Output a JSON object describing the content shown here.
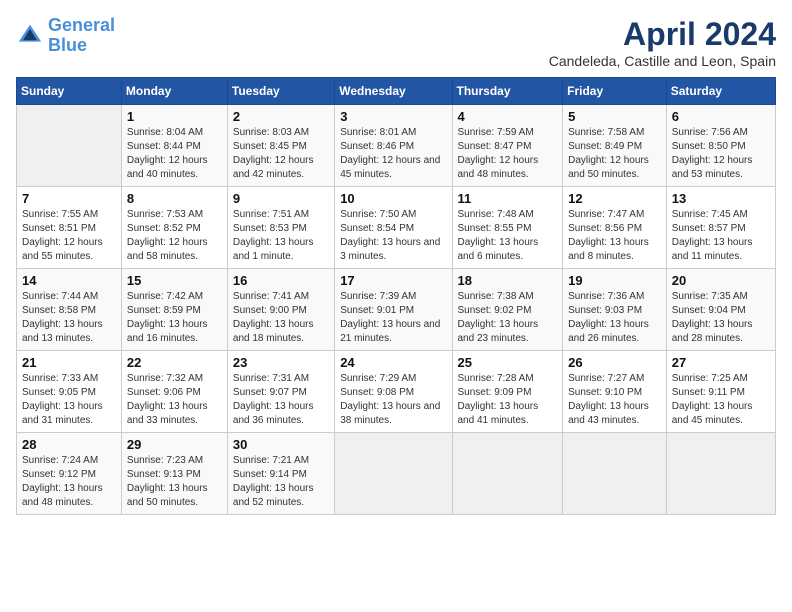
{
  "logo": {
    "line1": "General",
    "line2": "Blue"
  },
  "title": "April 2024",
  "subtitle": "Candeleda, Castille and Leon, Spain",
  "header_days": [
    "Sunday",
    "Monday",
    "Tuesday",
    "Wednesday",
    "Thursday",
    "Friday",
    "Saturday"
  ],
  "weeks": [
    [
      {
        "day": "",
        "empty": true
      },
      {
        "day": "1",
        "sunrise": "8:04 AM",
        "sunset": "8:44 PM",
        "daylight": "12 hours and 40 minutes."
      },
      {
        "day": "2",
        "sunrise": "8:03 AM",
        "sunset": "8:45 PM",
        "daylight": "12 hours and 42 minutes."
      },
      {
        "day": "3",
        "sunrise": "8:01 AM",
        "sunset": "8:46 PM",
        "daylight": "12 hours and 45 minutes."
      },
      {
        "day": "4",
        "sunrise": "7:59 AM",
        "sunset": "8:47 PM",
        "daylight": "12 hours and 48 minutes."
      },
      {
        "day": "5",
        "sunrise": "7:58 AM",
        "sunset": "8:49 PM",
        "daylight": "12 hours and 50 minutes."
      },
      {
        "day": "6",
        "sunrise": "7:56 AM",
        "sunset": "8:50 PM",
        "daylight": "12 hours and 53 minutes."
      }
    ],
    [
      {
        "day": "7",
        "sunrise": "7:55 AM",
        "sunset": "8:51 PM",
        "daylight": "12 hours and 55 minutes."
      },
      {
        "day": "8",
        "sunrise": "7:53 AM",
        "sunset": "8:52 PM",
        "daylight": "12 hours and 58 minutes."
      },
      {
        "day": "9",
        "sunrise": "7:51 AM",
        "sunset": "8:53 PM",
        "daylight": "13 hours and 1 minute."
      },
      {
        "day": "10",
        "sunrise": "7:50 AM",
        "sunset": "8:54 PM",
        "daylight": "13 hours and 3 minutes."
      },
      {
        "day": "11",
        "sunrise": "7:48 AM",
        "sunset": "8:55 PM",
        "daylight": "13 hours and 6 minutes."
      },
      {
        "day": "12",
        "sunrise": "7:47 AM",
        "sunset": "8:56 PM",
        "daylight": "13 hours and 8 minutes."
      },
      {
        "day": "13",
        "sunrise": "7:45 AM",
        "sunset": "8:57 PM",
        "daylight": "13 hours and 11 minutes."
      }
    ],
    [
      {
        "day": "14",
        "sunrise": "7:44 AM",
        "sunset": "8:58 PM",
        "daylight": "13 hours and 13 minutes."
      },
      {
        "day": "15",
        "sunrise": "7:42 AM",
        "sunset": "8:59 PM",
        "daylight": "13 hours and 16 minutes."
      },
      {
        "day": "16",
        "sunrise": "7:41 AM",
        "sunset": "9:00 PM",
        "daylight": "13 hours and 18 minutes."
      },
      {
        "day": "17",
        "sunrise": "7:39 AM",
        "sunset": "9:01 PM",
        "daylight": "13 hours and 21 minutes."
      },
      {
        "day": "18",
        "sunrise": "7:38 AM",
        "sunset": "9:02 PM",
        "daylight": "13 hours and 23 minutes."
      },
      {
        "day": "19",
        "sunrise": "7:36 AM",
        "sunset": "9:03 PM",
        "daylight": "13 hours and 26 minutes."
      },
      {
        "day": "20",
        "sunrise": "7:35 AM",
        "sunset": "9:04 PM",
        "daylight": "13 hours and 28 minutes."
      }
    ],
    [
      {
        "day": "21",
        "sunrise": "7:33 AM",
        "sunset": "9:05 PM",
        "daylight": "13 hours and 31 minutes."
      },
      {
        "day": "22",
        "sunrise": "7:32 AM",
        "sunset": "9:06 PM",
        "daylight": "13 hours and 33 minutes."
      },
      {
        "day": "23",
        "sunrise": "7:31 AM",
        "sunset": "9:07 PM",
        "daylight": "13 hours and 36 minutes."
      },
      {
        "day": "24",
        "sunrise": "7:29 AM",
        "sunset": "9:08 PM",
        "daylight": "13 hours and 38 minutes."
      },
      {
        "day": "25",
        "sunrise": "7:28 AM",
        "sunset": "9:09 PM",
        "daylight": "13 hours and 41 minutes."
      },
      {
        "day": "26",
        "sunrise": "7:27 AM",
        "sunset": "9:10 PM",
        "daylight": "13 hours and 43 minutes."
      },
      {
        "day": "27",
        "sunrise": "7:25 AM",
        "sunset": "9:11 PM",
        "daylight": "13 hours and 45 minutes."
      }
    ],
    [
      {
        "day": "28",
        "sunrise": "7:24 AM",
        "sunset": "9:12 PM",
        "daylight": "13 hours and 48 minutes."
      },
      {
        "day": "29",
        "sunrise": "7:23 AM",
        "sunset": "9:13 PM",
        "daylight": "13 hours and 50 minutes."
      },
      {
        "day": "30",
        "sunrise": "7:21 AM",
        "sunset": "9:14 PM",
        "daylight": "13 hours and 52 minutes."
      },
      {
        "day": "",
        "empty": true
      },
      {
        "day": "",
        "empty": true
      },
      {
        "day": "",
        "empty": true
      },
      {
        "day": "",
        "empty": true
      }
    ]
  ],
  "labels": {
    "sunrise": "Sunrise:",
    "sunset": "Sunset:",
    "daylight": "Daylight hours"
  }
}
